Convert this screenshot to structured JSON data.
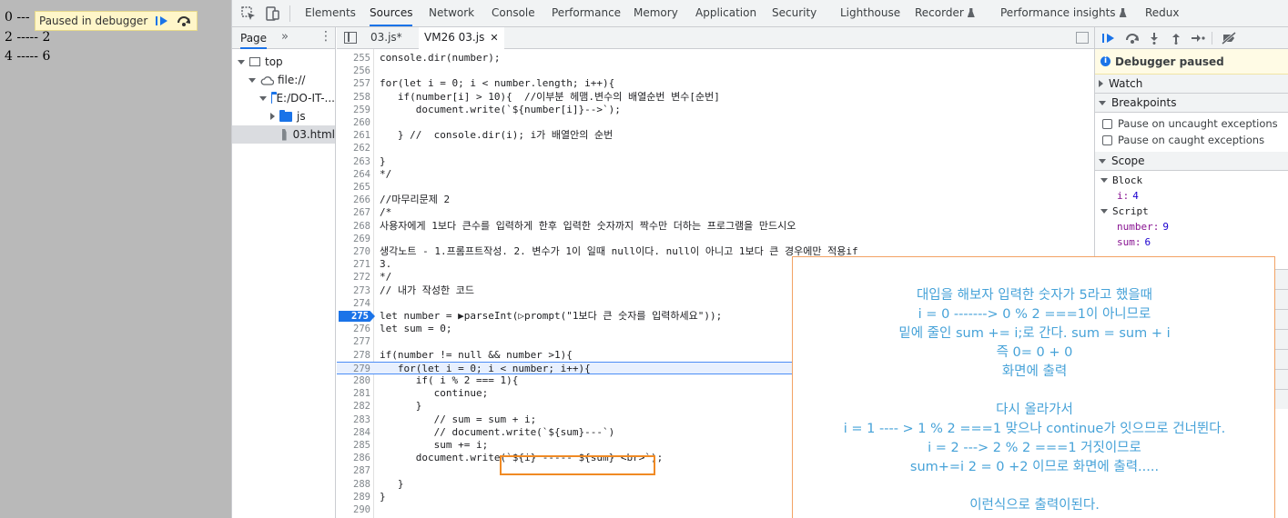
{
  "page": {
    "output_lines": [
      "0 ---",
      "2 ----- 2",
      "4 ----- 6"
    ],
    "paused_label": "Paused in debugger"
  },
  "topbar": {
    "tabs": [
      "Elements",
      "Sources",
      "Network",
      "Console",
      "Performance",
      "Memory",
      "Application",
      "Security",
      "Lighthouse",
      "Recorder",
      "Performance insights",
      "Redux"
    ],
    "active_tab": "Sources"
  },
  "navigator": {
    "tab_label": "Page",
    "more_label": "»",
    "tree": [
      "top",
      "file://",
      "E:/DO-IT-...",
      "js",
      "03.html"
    ]
  },
  "editor": {
    "tabs": [
      "03.js*",
      "VM26 03.js"
    ],
    "close_glyph": "✕"
  },
  "code_lines": [
    {
      "n": "255",
      "t": "console.dir(number);"
    },
    {
      "n": "256",
      "t": ""
    },
    {
      "n": "257",
      "t": "for(let i = 0; i < number.length; i++){"
    },
    {
      "n": "258",
      "t": "   if(number[i] > 10){  //이부분 헤맴.변수의 배열순번 변수[순번]"
    },
    {
      "n": "259",
      "t": "      document.write(`${number[i]}-->`);"
    },
    {
      "n": "260",
      "t": ""
    },
    {
      "n": "261",
      "t": "   } //  console.dir(i); i가 배열안의 순번"
    },
    {
      "n": "262",
      "t": ""
    },
    {
      "n": "263",
      "t": "}"
    },
    {
      "n": "264",
      "t": "*/"
    },
    {
      "n": "265",
      "t": ""
    },
    {
      "n": "266",
      "t": "//마무리문제 2"
    },
    {
      "n": "267",
      "t": "/*"
    },
    {
      "n": "268",
      "t": "사용자에게 1보다 큰수를 입력하게 한후 입력한 숫자까지 짝수만 더하는 프로그램을 만드시오"
    },
    {
      "n": "269",
      "t": ""
    },
    {
      "n": "270",
      "t": "생각노트 - 1.프롬프트작성. 2. 변수가 1이 일때 null이다. null이 아니고 1보다 큰 경우에만 적용if"
    },
    {
      "n": "271",
      "t": "3."
    },
    {
      "n": "272",
      "t": "*/"
    },
    {
      "n": "273",
      "t": "// 내가 작성한 코드"
    },
    {
      "n": "274",
      "t": ""
    },
    {
      "n": "275",
      "t": "let number = ▶parseInt(▷prompt(\"1보다 큰 숫자를 입력하세요\"));"
    },
    {
      "n": "276",
      "t": "let sum = 0;"
    },
    {
      "n": "277",
      "t": ""
    },
    {
      "n": "278",
      "t": "if(number != null && number >1){"
    },
    {
      "n": "279",
      "t": "   for(let i = 0; i < number; i++){"
    },
    {
      "n": "280",
      "t": "      if( i % 2 === 1){"
    },
    {
      "n": "281",
      "t": "         continue;"
    },
    {
      "n": "282",
      "t": "      }"
    },
    {
      "n": "283",
      "t": "         // sum = sum + i;"
    },
    {
      "n": "284",
      "t": "         // document.write(`${sum}---`)"
    },
    {
      "n": "285",
      "t": "         sum += i;"
    },
    {
      "n": "286",
      "t": "      document.write(`${i} ----- ${sum} <br>`);"
    },
    {
      "n": "287",
      "t": ""
    },
    {
      "n": "288",
      "t": "   }"
    },
    {
      "n": "289",
      "t": "}"
    },
    {
      "n": "290",
      "t": ""
    }
  ],
  "sidebar": {
    "paused_title": "Debugger paused",
    "watch": "Watch",
    "breakpoints": "Breakpoints",
    "pause_uncaught": "Pause on uncaught exceptions",
    "pause_caught": "Pause on caught exceptions",
    "scope": "Scope",
    "block": "Block",
    "block_var": {
      "k": "i:",
      "v": "4"
    },
    "script": "Script",
    "script_vars": [
      {
        "k": "number:",
        "v": "9"
      },
      {
        "k": "sum:",
        "v": "6"
      }
    ]
  },
  "annotation": {
    "lines": [
      "대입을 해보자 입력한 숫자가 5라고 했을때",
      "i = 0 -------> 0 % 2 ===1이 아니므로",
      "밑에 줄인 sum += i;로 간다. sum = sum + i",
      "즉 0= 0 + 0",
      "화면에 출력",
      "",
      "다시 올라가서",
      "i = 1 ---- >  1 % 2 ===1 맞으나 continue가 잇으므로 건너뛴다.",
      "i = 2 --->  2 % 2 ===1 거짓이므로",
      "sum+=i    2 = 0 +2 이므로 화면에 출력.....",
      "",
      "이런식으로 출력이된다."
    ]
  },
  "colors": {
    "accent": "#1a73e8",
    "highlight": "#f08a24",
    "annotation_text": "#46a2d8"
  }
}
